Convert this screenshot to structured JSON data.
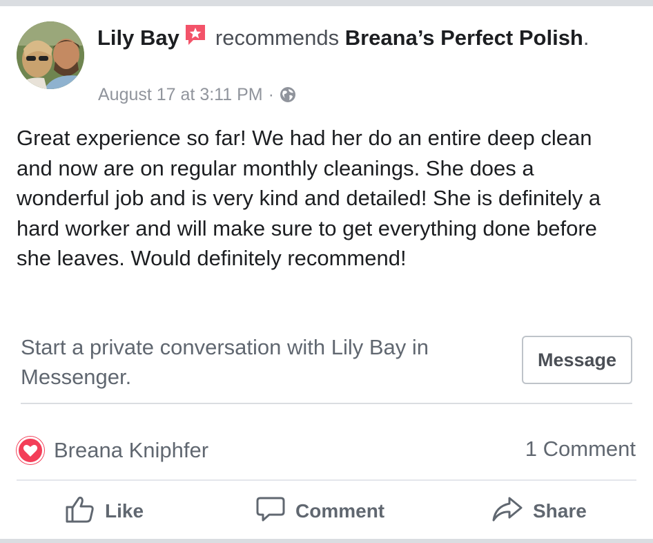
{
  "post": {
    "author": "Lily Bay",
    "verb": "recommends",
    "page": "Breana’s Perfect Polish",
    "period": ".",
    "timestamp": "August 17 at 3:11 PM",
    "separator": "·",
    "text": "Great experience so far! We had her do an entire deep clean and now are on regular monthly cleanings. She does a wonderful job and is very kind and detailed! She is definitely a hard worker and will make sure to get everything done before she leaves. Would definitely recommend!"
  },
  "messenger": {
    "prompt": "Start a private conversation with Lily Bay in Messenger.",
    "button_label": "Message"
  },
  "reactions": {
    "reactor": "Breana Kniphfer",
    "comments": "1 Comment"
  },
  "actions": {
    "like": "Like",
    "comment": "Comment",
    "share": "Share"
  },
  "colors": {
    "recommend_icon": "#f35369",
    "heart": "#f33e58",
    "secondary_text": "#606770",
    "meta_text": "#90949c"
  },
  "icons": [
    "recommend-icon",
    "globe-icon",
    "heart-icon",
    "like-icon",
    "comment-icon",
    "share-icon"
  ]
}
